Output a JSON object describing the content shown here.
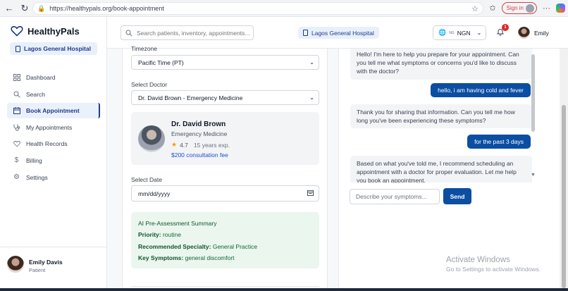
{
  "browser": {
    "url": "https://healthypals.org/book-appointment",
    "sign_in_label": "Sign in"
  },
  "app": {
    "brand": "HealthyPals",
    "hospital": "Lagos General Hospital"
  },
  "sidebar": {
    "items": [
      {
        "label": "Dashboard",
        "icon": "grid-icon"
      },
      {
        "label": "Search",
        "icon": "search-icon"
      },
      {
        "label": "Book Appointment",
        "icon": "calendar-icon",
        "active": true
      },
      {
        "label": "My Appointments",
        "icon": "stethoscope-icon"
      },
      {
        "label": "Health Records",
        "icon": "heart-icon"
      },
      {
        "label": "Billing",
        "icon": "dollar-icon"
      },
      {
        "label": "Settings",
        "icon": "gear-icon"
      }
    ],
    "user": {
      "name": "Emily Davis",
      "role": "Patient"
    }
  },
  "header": {
    "search_placeholder": "Search patients, inventory, appointments...",
    "hospital": "Lagos General Hospital",
    "currency_flag": "NG",
    "currency": "NGN",
    "notification_count": "1",
    "user_name": "Emily"
  },
  "form": {
    "timezone_label": "Timezone",
    "timezone_value": "Pacific Time (PT)",
    "doctor_label": "Select Doctor",
    "doctor_value": "Dr. David Brown - Emergency Medicine",
    "doctor": {
      "name": "Dr. David Brown",
      "specialty": "Emergency Medicine",
      "rating": "4.7",
      "experience": "15 years exp.",
      "fee": "$200 consultation fee"
    },
    "date_label": "Select Date",
    "date_placeholder": "mm/dd/yyyy",
    "summary": {
      "title": "AI Pre-Assessment Summary",
      "priority_label": "Priority:",
      "priority_value": "routine",
      "specialty_label": "Recommended Specialty:",
      "specialty_value": "General Practice",
      "symptoms_label": "Key Symptoms:",
      "symptoms_value": "general discomfort"
    }
  },
  "chat": {
    "messages": [
      {
        "from": "ai",
        "text": "Hello! I'm here to help you prepare for your appointment. Can you tell me what symptoms or concerns you'd like to discuss with the doctor?"
      },
      {
        "from": "user",
        "text": "hello, i am having cold and fever"
      },
      {
        "from": "ai",
        "text": "Thank you for sharing that information. Can you tell me how long you've been experiencing these symptoms?"
      },
      {
        "from": "user",
        "text": "for the past 3 days"
      },
      {
        "from": "ai",
        "text": "Based on what you've told me, I recommend scheduling an appointment with a doctor for proper evaluation. Let me help you book an appointment."
      }
    ],
    "input_placeholder": "Describe your symptoms...",
    "send_label": "Send"
  },
  "watermark": {
    "line1": "Activate Windows",
    "line2": "Go to Settings to activate Windows."
  }
}
